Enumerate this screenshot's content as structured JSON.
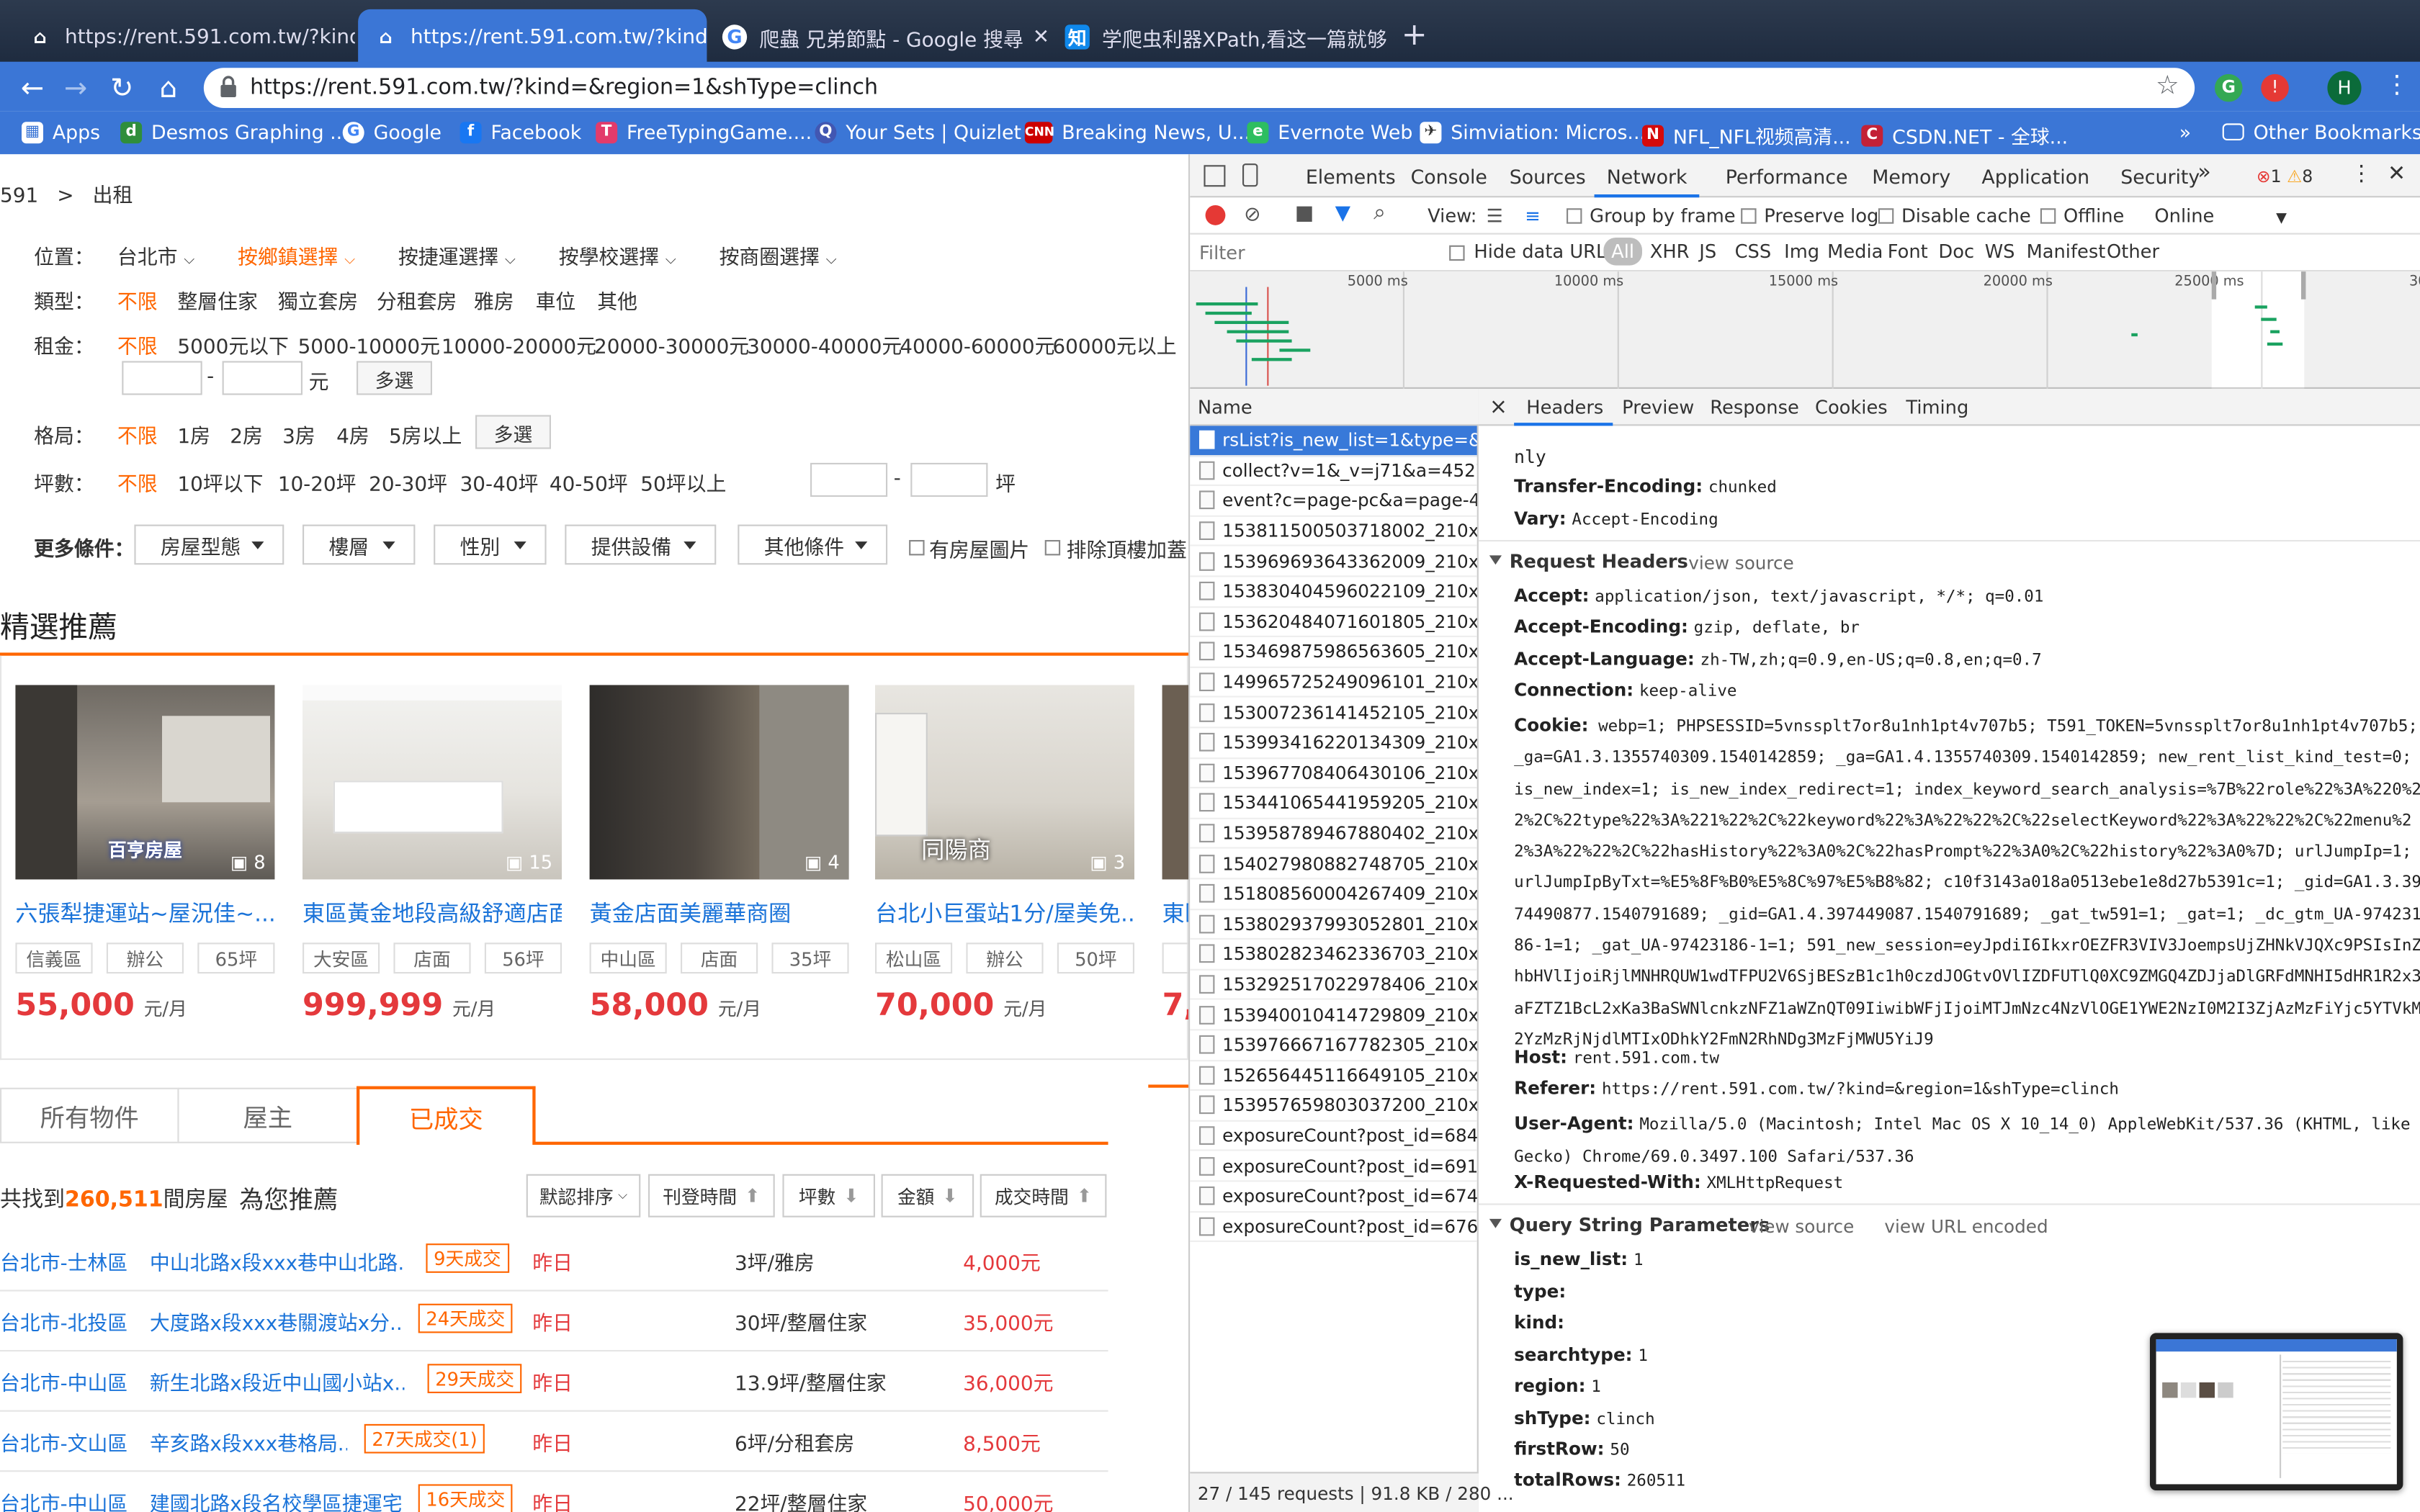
{
  "browser": {
    "tabs": [
      {
        "title": "https://rent.591.com.tw/?kind=",
        "active": false
      },
      {
        "title": "https://rent.591.com.tw/?kind=",
        "active": true
      },
      {
        "title": "爬蟲 兄弟節點 - Google 搜尋",
        "active": false
      },
      {
        "title": "学爬虫利器XPath,看这一篇就够",
        "active": false
      }
    ],
    "new_tab": "+",
    "url": "https://rent.591.com.tw/?kind=&region=1&shType=clinch",
    "profile_initial": "H",
    "bookmarks": [
      "Apps",
      "Desmos Graphing ...",
      "Google",
      "Facebook",
      "FreeTypingGame....",
      "Your Sets | Quizlet",
      "Breaking News, U....",
      "Evernote Web",
      "Simviation: Micros...",
      "NFL_NFL视频高清...",
      "CSDN.NET - 全球..."
    ],
    "bookmarks_more": "»",
    "other_bookmarks": "Other Bookmarks"
  },
  "page": {
    "breadcrumb": {
      "site": "591",
      "sep": ">",
      "current": "出租"
    },
    "filters": {
      "location_label": "位置：",
      "location_items": [
        "台北市",
        "按鄉鎮選擇",
        "按捷運選擇",
        "按學校選擇",
        "按商圈選擇"
      ],
      "type_label": "類型：",
      "type_items": [
        "不限",
        "整層住家",
        "獨立套房",
        "分租套房",
        "雅房",
        "車位",
        "其他"
      ],
      "rent_label": "租金：",
      "rent_items": [
        "不限",
        "5000元以下",
        "5000-10000元",
        "10000-20000元",
        "20000-30000元",
        "30000-40000元",
        "40000-60000元",
        "60000元以上"
      ],
      "rent_dash": "-",
      "rent_unit": "元",
      "rent_multi": "多選",
      "layout_label": "格局：",
      "layout_items": [
        "不限",
        "1房",
        "2房",
        "3房",
        "4房",
        "5房以上"
      ],
      "layout_multi": "多選",
      "size_label": "坪數：",
      "size_items": [
        "不限",
        "10坪以下",
        "10-20坪",
        "20-30坪",
        "30-40坪",
        "40-50坪",
        "50坪以上"
      ],
      "size_dash": "-",
      "size_unit": "坪",
      "more_label": "更多條件：",
      "more_dropdowns": [
        "房屋型態",
        "樓層",
        "性別",
        "提供設備",
        "其他條件"
      ],
      "checkboxes": [
        "有房屋圖片",
        "排除頂樓加蓋"
      ]
    },
    "featured_title": "精選推薦",
    "featured": [
      {
        "title": "六張犁捷運站~屋況佳~...",
        "tags": [
          "信義區",
          "辦公",
          "65坪"
        ],
        "price": "55,000",
        "unit": "元/月",
        "photos": "8",
        "watermark": "百亨房屋"
      },
      {
        "title": "東區黃金地段高級舒適店面",
        "tags": [
          "大安區",
          "店面",
          "56坪"
        ],
        "price": "999,999",
        "unit": "元/月",
        "photos": "15",
        "watermark": ""
      },
      {
        "title": "黃金店面美麗華商圈",
        "tags": [
          "中山區",
          "店面",
          "35坪"
        ],
        "price": "58,000",
        "unit": "元/月",
        "photos": "4",
        "watermark": ""
      },
      {
        "title": "台北小巨蛋站1分/屋美免...",
        "tags": [
          "松山區",
          "辦公",
          "50坪"
        ],
        "price": "70,000",
        "unit": "元/月",
        "photos": "3",
        "watermark": "同陽商"
      },
      {
        "title": "東區",
        "tags": [
          "大"
        ],
        "price": "7,",
        "unit": "",
        "photos": "",
        "watermark": ""
      }
    ],
    "list_tabs": [
      "所有物件",
      "屋主",
      "已成交"
    ],
    "result_prefix": "共找到",
    "result_count": "260,511",
    "result_suffix": "間房屋",
    "recommend": "為您推薦",
    "sort_buttons": [
      "默認排序",
      "刊登時間",
      "坪數",
      "金額",
      "成交時間"
    ],
    "rows": [
      {
        "area": "台北市-士林區",
        "addr": "中山北路x段xxx巷中山北路...",
        "badge": "9天成交",
        "when": "昨日",
        "size": "3坪/雅房",
        "price": "4,000元"
      },
      {
        "area": "台北市-北投區",
        "addr": "大度路x段xxx巷關渡站x分...",
        "badge": "24天成交",
        "when": "昨日",
        "size": "30坪/整層住家",
        "price": "35,000元"
      },
      {
        "area": "台北市-中山區",
        "addr": "新生北路x段近中山國小站x...",
        "badge": "29天成交",
        "when": "昨日",
        "size": "13.9坪/整層住家",
        "price": "36,000元"
      },
      {
        "area": "台北市-文山區",
        "addr": "辛亥路x段xxx巷格局...",
        "badge": "27天成交(1)",
        "when": "昨日",
        "size": "6坪/分租套房",
        "price": "8,500元"
      },
      {
        "area": "台北市-中山區",
        "addr": "建國北路x段名校學區捷運宅",
        "badge": "16天成交",
        "when": "昨日",
        "size": "22坪/整層住家",
        "price": "50,000元"
      }
    ]
  },
  "devtools": {
    "tabs": [
      "Elements",
      "Console",
      "Sources",
      "Network",
      "Performance",
      "Memory",
      "Application",
      "Security"
    ],
    "active_tab": "Network",
    "more": "»",
    "errors": "1",
    "warnings": "8",
    "toolbar": {
      "view": "View:",
      "group_by_frame": "Group by frame",
      "preserve_log": "Preserve log",
      "disable_cache": "Disable cache",
      "offline": "Offline",
      "online": "Online"
    },
    "filter_placeholder": "Filter",
    "hide_data_urls": "Hide data URLs",
    "type_filters": [
      "All",
      "XHR",
      "JS",
      "CSS",
      "Img",
      "Media",
      "Font",
      "Doc",
      "WS",
      "Manifest",
      "Other"
    ],
    "timeline_ticks": [
      "5000 ms",
      "10000 ms",
      "15000 ms",
      "20000 ms",
      "25000 ms",
      "30"
    ],
    "name_header": "Name",
    "requests": [
      "rsList?is_new_list=1&type=&k...",
      "collect?v=1&_v=j71&a=45279...",
      "event?c=page-pc&a=page-4...",
      "15381150050371​8002_210x1...",
      "153969693643362009_210x1...",
      "153830404596022109_210x1...",
      "153620484071601805_210x1...",
      "153469875986563605_210x1...",
      "149965725249096101_210x1...",
      "153007236141452105_210x1...",
      "153993416220134309_210x1...",
      "153967708406430106_210x1...",
      "153441065441959205_210x1...",
      "153958789467880402_210x1...",
      "154027980882748705_210x1...",
      "151808560004267409_210x1...",
      "153802937993052801_210x1...",
      "153802823462336703_210x1...",
      "153292517022978406_210x1...",
      "153940010414729809_210x1...",
      "153976667167782305_210x1...",
      "152656445116649105_210x1...",
      "153957659803037200_210x1...",
      "exposureCount?post_id=684...",
      "exposureCount?post_id=691...",
      "exposureCount?post_id=674...",
      "exposureCount?post_id=676..."
    ],
    "detail_tabs": [
      "Headers",
      "Preview",
      "Response",
      "Cookies",
      "Timing"
    ],
    "close": "×",
    "resp_top": "nly",
    "resp_headers": [
      {
        "k": "Transfer-Encoding:",
        "v": "chunked"
      },
      {
        "k": "Vary:",
        "v": "Accept-Encoding"
      }
    ],
    "request_headers_title": "Request Headers",
    "view_source": "view source",
    "req_headers": [
      {
        "k": "Accept:",
        "v": "application/json, text/javascript, */*; q=0.01"
      },
      {
        "k": "Accept-Encoding:",
        "v": "gzip, deflate, br"
      },
      {
        "k": "Accept-Language:",
        "v": "zh-TW,zh;q=0.9,en-US;q=0.8,en;q=0.7"
      },
      {
        "k": "Connection:",
        "v": "keep-alive"
      }
    ],
    "cookie_key": "Cookie:",
    "cookie_value": "webp=1; PHPSESSID=5vnssplt7or8u1nh1pt4v707b5; T591_TOKEN=5vnssplt7or8u1nh1pt4v707b5; _ga=GA1.3.1355740309.1540142859; _ga=GA1.4.1355740309.1540142859; new_rent_list_kind_test=0; is_new_index=1; is_new_index_redirect=1; index_keyword_search_analysis=%7B%22role%22%3A%220%22%2C%22type%22%3A%221%22%2C%22keyword%22%3A%22%22%2C%22selectKeyword%22%3A%22%22%2C%22menu%22%3A%22%22%2C%22hasHistory%22%3A0%2C%22hasPrompt%22%3A0%2C%22history%22%3A0%7D; urlJumpIp=1; urlJumpIpByTxt=%E5%8F%B0%E5%8C%97%E5%B8%82; c10f3143a018a0513ebe1e8d27b5391c=1; _gid=GA1.3.3974490877.1540791689; _gid=GA1.4.397449087.1540791689; _gat_tw591=1; _gat=1; _dc_gtm_UA-97423186-1=1; _gat_UA-97423186-1=1; 591_new_session=eyJpdiI6IkxrOEZFR3VIV3JoempsUjZHNkVJQXc9PSIsInZhbHVlIjoiRjlMNHRQUW1wdTFPU2V6SjBESzB1c1h0czdJOGtvOVlIZDFUTlQ0XC9ZMGQ4ZDJjaDlGRFdMNHI5dHR1R2x3aFZTZ1BcL2xKa3BaSWNlcnkzNFZ1aWZnQT09IiwibWFjIjoiMTJmNzc4NzVlOGE1YWE2NzI0M2I3ZjAzMzFiYjc5YTVkM2YzMzRjNjdlMTIxODhkY2FmN2RhNDg3MzFjMWU5YiJ9",
    "req_headers2": [
      {
        "k": "Host:",
        "v": "rent.591.com.tw"
      },
      {
        "k": "Referer:",
        "v": "https://rent.591.com.tw/?kind=&region=1&shType=clinch"
      },
      {
        "k": "User-Agent:",
        "v": "Mozilla/5.0 (Macintosh; Intel Mac OS X 10_14_0) AppleWebKit/537.36 (KHTML, like Gecko) Chrome/69.0.3497.100 Safari/537.36"
      },
      {
        "k": "X-Requested-With:",
        "v": "XMLHttpRequest"
      }
    ],
    "qs_title": "Query String Parameters",
    "view_url_encoded": "view URL encoded",
    "qs": [
      {
        "k": "is_new_list:",
        "v": "1"
      },
      {
        "k": "type:",
        "v": ""
      },
      {
        "k": "kind:",
        "v": ""
      },
      {
        "k": "searchtype:",
        "v": "1"
      },
      {
        "k": "region:",
        "v": "1"
      },
      {
        "k": "shType:",
        "v": "clinch"
      },
      {
        "k": "firstRow:",
        "v": "50"
      },
      {
        "k": "totalRows:",
        "v": "260511"
      }
    ],
    "status": "27 / 145 requests | 91.8 KB / 280 ..."
  },
  "colors": {
    "chrome_blue": "#3b76d6",
    "accent_orange": "#ff6600",
    "price_red": "#e4393c",
    "link_blue": "#1a73d9",
    "dev_select": "#3879d9"
  }
}
